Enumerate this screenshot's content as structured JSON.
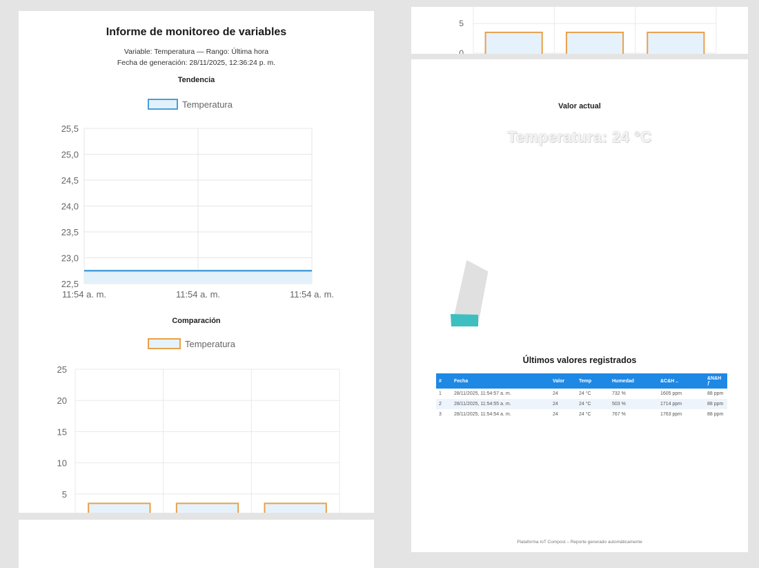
{
  "report": {
    "title": "Informe de monitoreo de variables",
    "subtitle": "Variable: Temperatura — Rango: Última hora",
    "generated": "Fecha de generación: 28/11/2025, 12:36:24 p. m.",
    "trend_heading": "Tendencia",
    "compare_heading": "Comparación",
    "current_heading": "Valor actual",
    "current_value": "Temperatura: 24 °C",
    "table_heading": "Últimos valores registrados",
    "footer": "Plataforma IoT Compost – Reporte generado automáticamente"
  },
  "colors": {
    "line": "#4a9ed8",
    "line_fill": "#e3f1fb",
    "bar_border": "#e8a04a",
    "bar_fill": "#e6f2fb",
    "gauge_fill": "#3ebfbf",
    "gauge_track": "#e0e0e0",
    "table_header": "#1e88e5"
  },
  "chart_data": [
    {
      "type": "line",
      "title": "Tendencia",
      "legend": [
        "Temperatura"
      ],
      "x": [
        "11:54 a. m.",
        "11:54 a. m.",
        "11:54 a. m."
      ],
      "series": [
        {
          "name": "Temperatura",
          "values": [
            22.75,
            22.75,
            22.75
          ]
        }
      ],
      "yticks": [
        "25,5",
        "25,0",
        "24,5",
        "24,0",
        "23,5",
        "23,0",
        "22,5"
      ],
      "ylim": [
        22.5,
        25.5
      ],
      "grid": true,
      "legend_position": "top"
    },
    {
      "type": "bar",
      "title": "Comparación",
      "legend": [
        "Temperatura"
      ],
      "categories": [
        "",
        "",
        ""
      ],
      "series": [
        {
          "name": "Temperatura",
          "values": [
            3.5,
            3.5,
            3.5
          ]
        }
      ],
      "yticks": [
        "25",
        "20",
        "15",
        "10",
        "5",
        "0"
      ],
      "ylim": [
        0,
        25
      ],
      "grid": true,
      "legend_position": "top"
    }
  ],
  "gauge": {
    "value": 24,
    "fraction": 0.2
  },
  "table": {
    "headers": [
      "#",
      "Fecha",
      "Valor",
      "Temp",
      "Humedad",
      "&C&H ..",
      "&N&H ƒ"
    ],
    "rows": [
      [
        "1",
        "28/11/2025, 11:54:57 a. m.",
        "24",
        "24 °C",
        "732 %",
        "1605 ppm",
        "88 ppm"
      ],
      [
        "2",
        "28/11/2025, 11:54:55 a. m.",
        "24",
        "24 °C",
        "503 %",
        "1714 ppm",
        "88 ppm"
      ],
      [
        "3",
        "28/11/2025, 11:54:54 a. m.",
        "24",
        "24 °C",
        "767 %",
        "1763 ppm",
        "88 ppm"
      ]
    ]
  }
}
